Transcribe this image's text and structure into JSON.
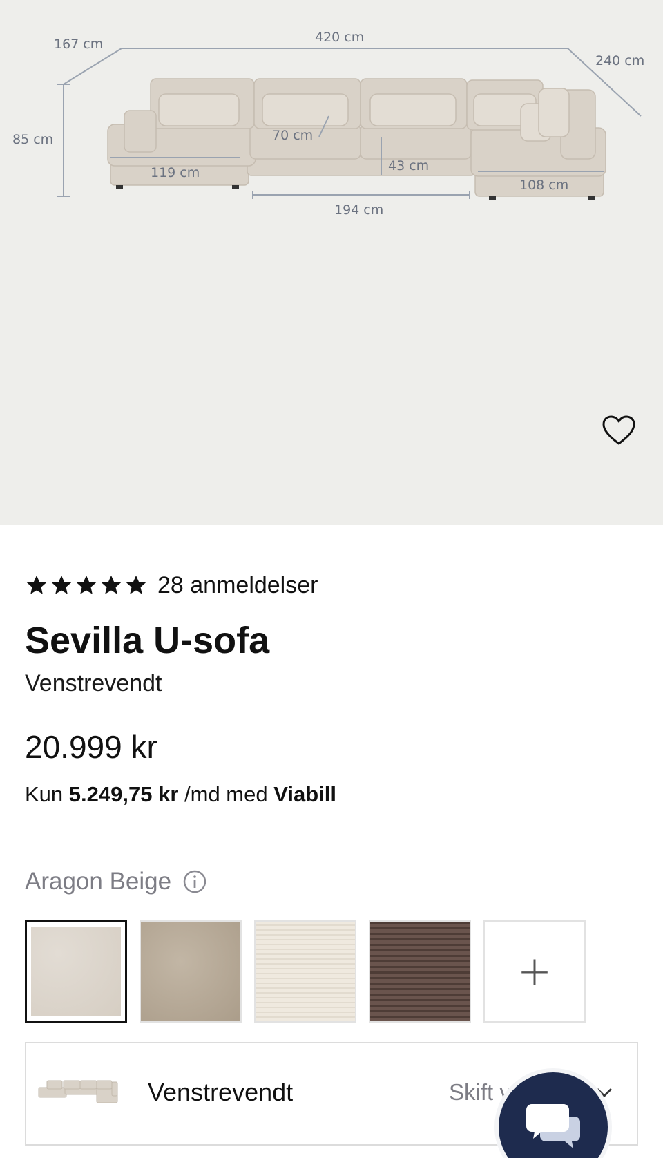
{
  "hero": {
    "dimensions": {
      "depth_left": "167 cm",
      "width_total": "420 cm",
      "depth_right": "240 cm",
      "height": "85 cm",
      "seat_depth": "70 cm",
      "chaise_left": "119 cm",
      "seat_height": "43 cm",
      "chaise_right": "108 cm",
      "middle": "194 cm"
    },
    "favorite_icon": "heart-outline-icon"
  },
  "product": {
    "rating_stars": 5,
    "reviews": "28 anmeldelser",
    "title": "Sevilla U-sofa",
    "subtitle": "Venstrevendt",
    "price": "20.999 kr",
    "finance": {
      "prefix": "Kun",
      "amount": "5.249,75 kr",
      "middle": "/md med",
      "provider": "Viabill"
    }
  },
  "color": {
    "name": "Aragon Beige",
    "info_icon": "info-icon",
    "swatches": [
      {
        "name": "Aragon Beige",
        "color": "#dcd5cc",
        "selected": true
      },
      {
        "name": "taupe",
        "color": "#b8aa98",
        "selected": false
      },
      {
        "name": "cream-stripe",
        "color": "#ebe4d8",
        "selected": false
      },
      {
        "name": "brown-stripe",
        "color": "#5e4a44",
        "selected": false
      }
    ],
    "more_label": "+"
  },
  "variant": {
    "label": "Venstrevendt",
    "change_label": "Skift vendi",
    "chevron_icon": "chevron-down-icon"
  },
  "chat": {
    "icon": "chat-bubbles-icon",
    "bg_color": "#1e2b4e"
  }
}
